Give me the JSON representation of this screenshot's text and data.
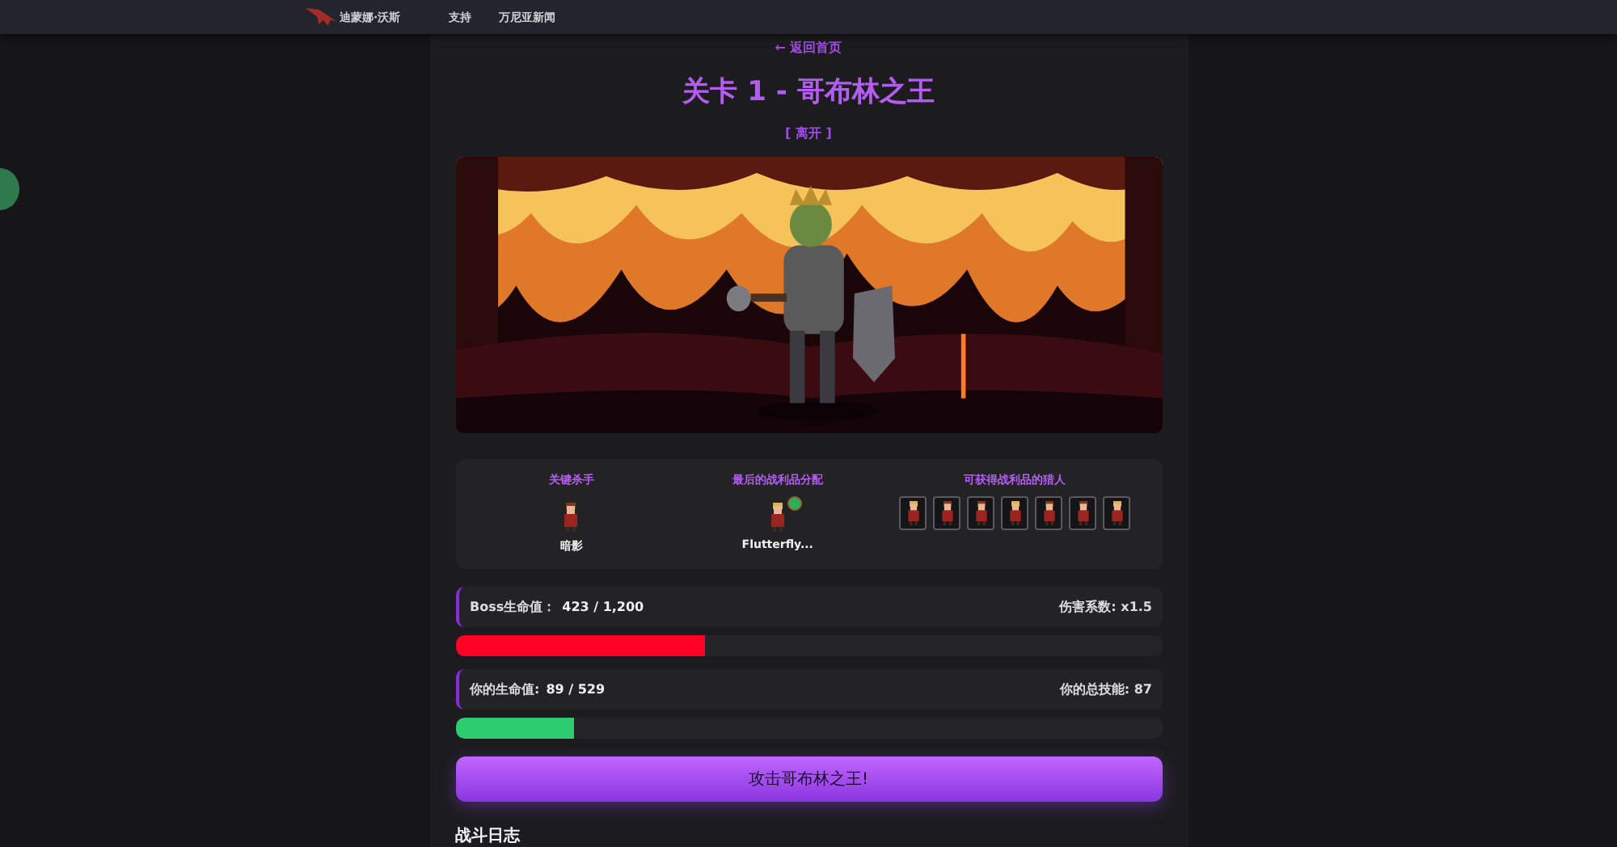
{
  "nav": {
    "brand": "迪蒙娜·沃斯",
    "links": [
      "支持",
      "万尼亚新闻"
    ]
  },
  "back_link": "← 返回首页",
  "title": "关卡 1 - 哥布林之王",
  "leave_link": "[ 离开 ]",
  "stats": {
    "key_killer": {
      "label": "关键杀手",
      "name": "暗影"
    },
    "last_loot": {
      "label": "最后的战利品分配",
      "name": "Flutterfly..."
    },
    "eligible": {
      "label": "可获得战利品的猎人",
      "hunters": [
        {
          "kind": "avatar"
        },
        {
          "kind": "avatar"
        },
        {
          "kind": "avatar"
        },
        {
          "kind": "avatar"
        },
        {
          "kind": "avatar"
        },
        {
          "kind": "avatar"
        },
        {
          "kind": "avatar"
        }
      ]
    }
  },
  "bars": [
    {
      "kind": "boss",
      "label": "Boss生命值：",
      "value": "423 / 1,200",
      "right": "伤害系数: x1.5",
      "level": 0.3525
    },
    {
      "kind": "player",
      "label": "你的生命值:",
      "value": "89 / 529",
      "right": "你的总技能: 87",
      "level": 0.168
    }
  ],
  "attack_button": "攻击哥布林之王!",
  "log_heading": "战斗日志"
}
